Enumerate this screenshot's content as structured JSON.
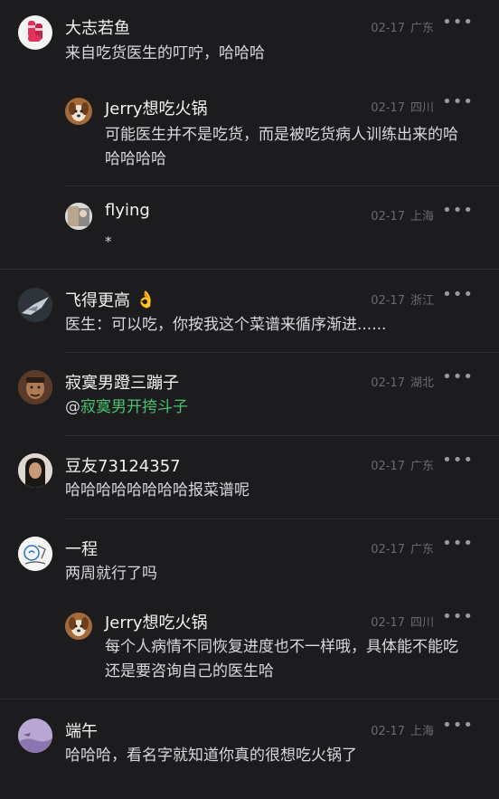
{
  "comments": [
    {
      "name": "大志若鱼",
      "date": "02-17",
      "location": "广东",
      "text": "来自吃货医生的叮咛，哈哈哈",
      "avatar_icon": "red-sock-avatar-icon"
    },
    {
      "name": "Jerry想吃火锅",
      "date": "02-17",
      "location": "四川",
      "text": "可能医生并不是吃货，而是被吃货病人训练出来的哈哈哈哈哈",
      "avatar_icon": "dog-avatar-icon"
    },
    {
      "name": "flying",
      "date": "02-17",
      "location": "上海",
      "text": "*",
      "avatar_icon": "photo-avatar-icon"
    },
    {
      "name": "飞得更高",
      "emoji": "👌",
      "date": "02-17",
      "location": "浙江",
      "text": "医生：可以吃，你按我这个菜谱来循序渐进......",
      "avatar_icon": "bird-avatar-icon"
    },
    {
      "name": "寂寞男蹬三蹦子",
      "date": "02-17",
      "location": "湖北",
      "text_prefix": "@",
      "mention": "寂寞男开挎斗子",
      "avatar_icon": "man-avatar-icon"
    },
    {
      "name": "豆友73124357",
      "date": "02-17",
      "location": "广东",
      "text": "哈哈哈哈哈哈哈哈报菜谱呢",
      "avatar_icon": "woman-avatar-icon"
    },
    {
      "name": "一程",
      "date": "02-17",
      "location": "广东",
      "text": "两周就行了吗",
      "avatar_icon": "sketch-avatar-icon"
    },
    {
      "name": "Jerry想吃火锅",
      "date": "02-17",
      "location": "四川",
      "text": "每个人病情不同恢复进度也不一样哦，具体能不能吃还是要咨询自己的医生哈",
      "avatar_icon": "dog-avatar-icon"
    },
    {
      "name": "端午",
      "date": "02-17",
      "location": "上海",
      "text": "哈哈哈，看名字就知道你真的很想吃火锅了",
      "avatar_icon": "purple-landscape-avatar-icon"
    }
  ],
  "more_label": "•••",
  "colors": {
    "background": "#1c1c1e",
    "mention": "#4cc06f",
    "meta": "#6a6a6e"
  }
}
